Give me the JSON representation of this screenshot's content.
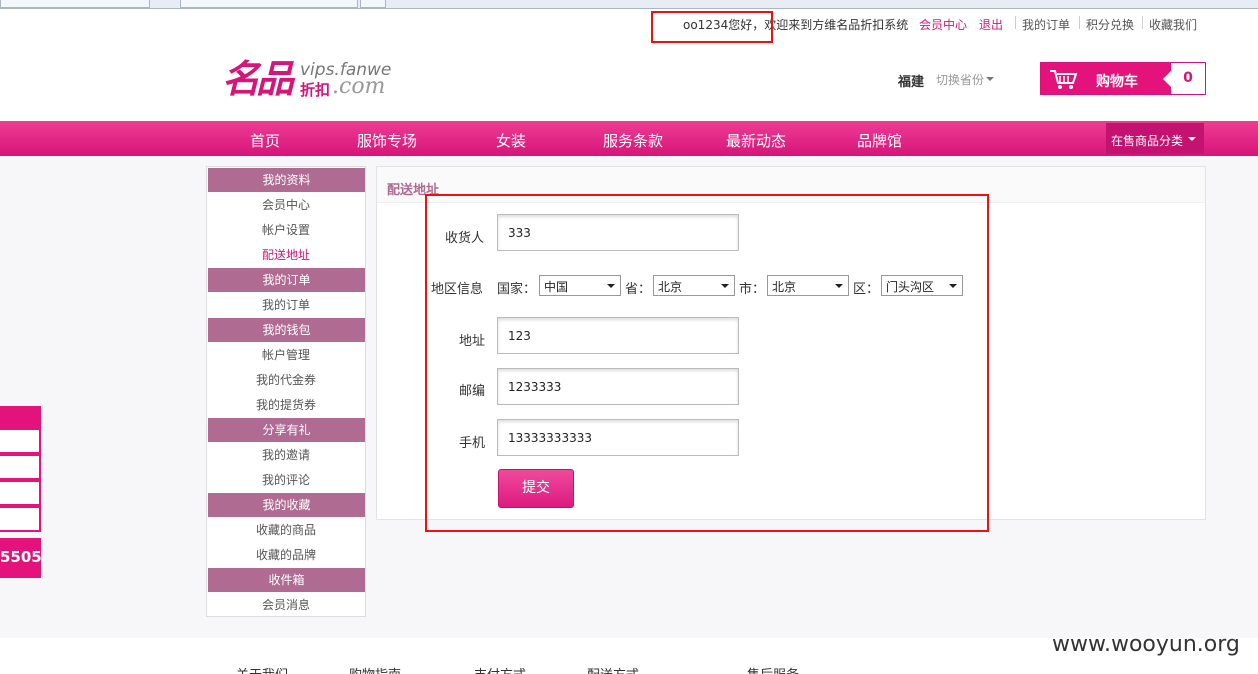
{
  "topbar": {
    "greeting": "oo1234您好，欢迎来到方维名品折扣系统",
    "member_center": "会员中心",
    "logout": "退出",
    "my_orders": "我的订单",
    "points_exchange": "积分兑换",
    "favorites": "收藏我们"
  },
  "logo": {
    "cn": "名品",
    "en1": "vips.fanwe",
    "cn2": "折扣",
    "en2": ".com"
  },
  "header": {
    "province": "福建",
    "switch_province": "切换省份",
    "cart_label": "购物车",
    "cart_count": "0"
  },
  "nav": {
    "items": [
      "首页",
      "服饰专场",
      "女装",
      "服务条款",
      "最新动态",
      "品牌馆"
    ],
    "category": "在售商品分类"
  },
  "sidebar": {
    "sections": [
      {
        "header": "我的资料",
        "items": [
          "会员中心",
          "帐户设置",
          "配送地址"
        ]
      },
      {
        "header": "我的订单",
        "items": [
          "我的订单"
        ]
      },
      {
        "header": "我的钱包",
        "items": [
          "帐户管理",
          "我的代金券",
          "我的提货券"
        ]
      },
      {
        "header": "分享有礼",
        "items": [
          "我的邀请",
          "我的评论"
        ]
      },
      {
        "header": "我的收藏",
        "items": [
          "收藏的商品",
          "收藏的品牌"
        ]
      },
      {
        "header": "收件箱",
        "items": [
          "会员消息"
        ]
      }
    ],
    "active": "配送地址"
  },
  "float": {
    "phone": "5505"
  },
  "form": {
    "title": "配送地址",
    "receiver_label": "收货人",
    "receiver_value": "333",
    "region_label": "地区信息",
    "country_label": "国家：",
    "country_value": "中国",
    "province_label": "省：",
    "province_value": "北京",
    "city_label": "市：",
    "city_value": "北京",
    "district_label": "区：",
    "district_value": "门头沟区",
    "address_label": "地址",
    "address_value": "123",
    "zip_label": "邮编",
    "zip_value": "1233333",
    "phone_label": "手机",
    "phone_value": "13333333333",
    "submit_label": "提交"
  },
  "footer": {
    "links": [
      "关于我们",
      "购物指南",
      "支付方式",
      "配送方式",
      "售后服务"
    ]
  },
  "watermark": "www.wooyun.org",
  "colors": {
    "brand": "#e4127b",
    "sidebar_header": "#b06b93",
    "highlight_box": "#ee1111"
  }
}
